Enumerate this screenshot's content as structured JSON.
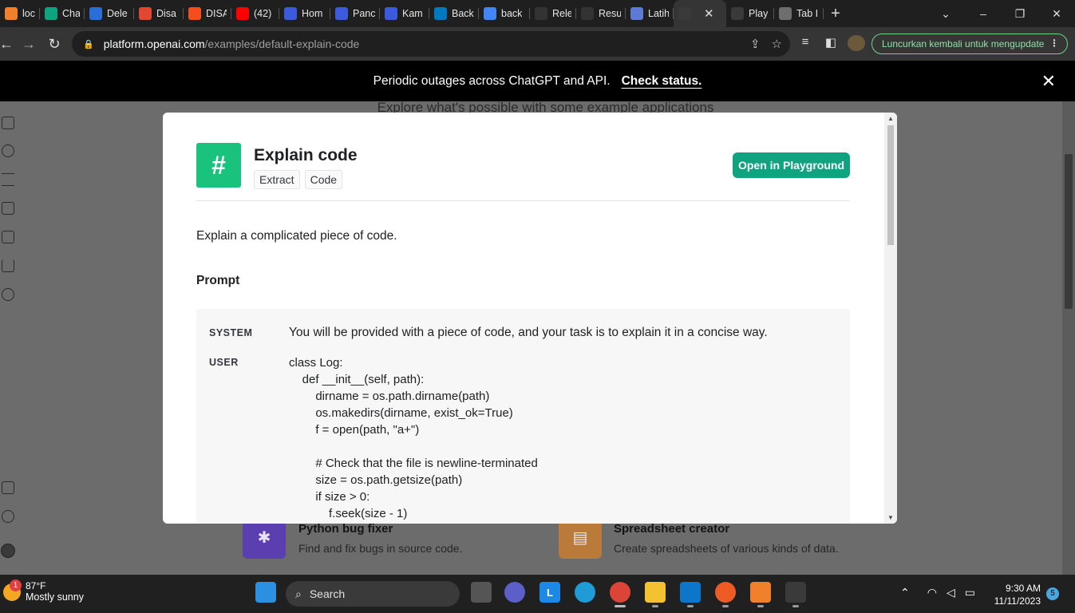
{
  "browser": {
    "tabs": [
      {
        "title": "local",
        "icon": "xampp-icon",
        "color": "#f0802b",
        "w": 50
      },
      {
        "title": "Chat",
        "icon": "openai-icon",
        "color": "#10a37f",
        "w": 56
      },
      {
        "title": "Dele",
        "icon": "gorm-icon",
        "color": "#2a6fd6",
        "w": 62
      },
      {
        "title": "Disa",
        "icon": "disa-icon",
        "color": "#e0492f",
        "w": 62
      },
      {
        "title": "DISA",
        "icon": "figma-icon",
        "color": "#f24e1e",
        "w": 60
      },
      {
        "title": "(42)",
        "icon": "youtube-icon",
        "color": "#ff0000",
        "w": 60
      },
      {
        "title": "Hom",
        "icon": "web-icon",
        "color": "#3b5bdb",
        "w": 64
      },
      {
        "title": "Panc",
        "icon": "web-icon",
        "color": "#3b5bdb",
        "w": 62
      },
      {
        "title": "Kam",
        "icon": "web-icon",
        "color": "#3b5bdb",
        "w": 62
      },
      {
        "title": "Back",
        "icon": "trello-icon",
        "color": "#0079bf",
        "w": 62
      },
      {
        "title": "back",
        "icon": "google-icon",
        "color": "#4285f4",
        "w": 64
      },
      {
        "title": "Rele",
        "icon": "github-icon",
        "color": "#333333",
        "w": 58
      },
      {
        "title": "Resu",
        "icon": "github-icon",
        "color": "#333333",
        "w": 62
      },
      {
        "title": "Latih",
        "icon": "web-icon",
        "color": "#5b7bd5",
        "w": 60
      },
      {
        "title": "",
        "icon": "openai-icon",
        "color": "#3a3a3a",
        "w": 66,
        "active": true
      },
      {
        "title": "Play",
        "icon": "openai-icon",
        "color": "#3a3a3a",
        "w": 60
      },
      {
        "title": "Tab I",
        "icon": "globe-icon",
        "color": "#6e6e6e",
        "w": 62
      }
    ],
    "new_tab": "+",
    "url_host": "platform.openai.com",
    "url_path": "/examples/default-explain-code",
    "update_button": "Luncurkan kembali untuk mengupdate"
  },
  "banner": {
    "text": "Periodic outages across ChatGPT and API.",
    "link": "Check status.",
    "close": "✕"
  },
  "page": {
    "headline": "Explore what's possible with some example applications",
    "cards": [
      {
        "title": "Python bug fixer",
        "desc": "Find and fix bugs in source code.",
        "icon": "bug-icon",
        "color": "#5b3fb0"
      },
      {
        "title": "Spreadsheet creator",
        "desc": "Create spreadsheets of various kinds of data.",
        "icon": "table-icon",
        "color": "#b97a3a"
      }
    ]
  },
  "modal": {
    "icon_glyph": "#",
    "title": "Explain code",
    "tags": [
      "Extract",
      "Code"
    ],
    "open_button": "Open in Playground",
    "description": "Explain a complicated piece of code.",
    "prompt_heading": "Prompt",
    "system_label": "SYSTEM",
    "system_text": "You will be provided with a piece of code, and your task is to explain it in a concise way.",
    "user_label": "USER",
    "code_lines": [
      "class Log:",
      "    def __init__(self, path):",
      "        dirname = os.path.dirname(path)",
      "        os.makedirs(dirname, exist_ok=True)",
      "        f = open(path, \"a+\")",
      "",
      "        # Check that the file is newline-terminated",
      "        size = os.path.getsize(path)",
      "        if size > 0:",
      "            f.seek(size - 1)"
    ]
  },
  "taskbar": {
    "temp": "87°F",
    "weather": "Mostly sunny",
    "weather_badge": "1",
    "search": "Search",
    "time": "9:30 AM",
    "date": "11/11/2023",
    "notifications": "5"
  }
}
